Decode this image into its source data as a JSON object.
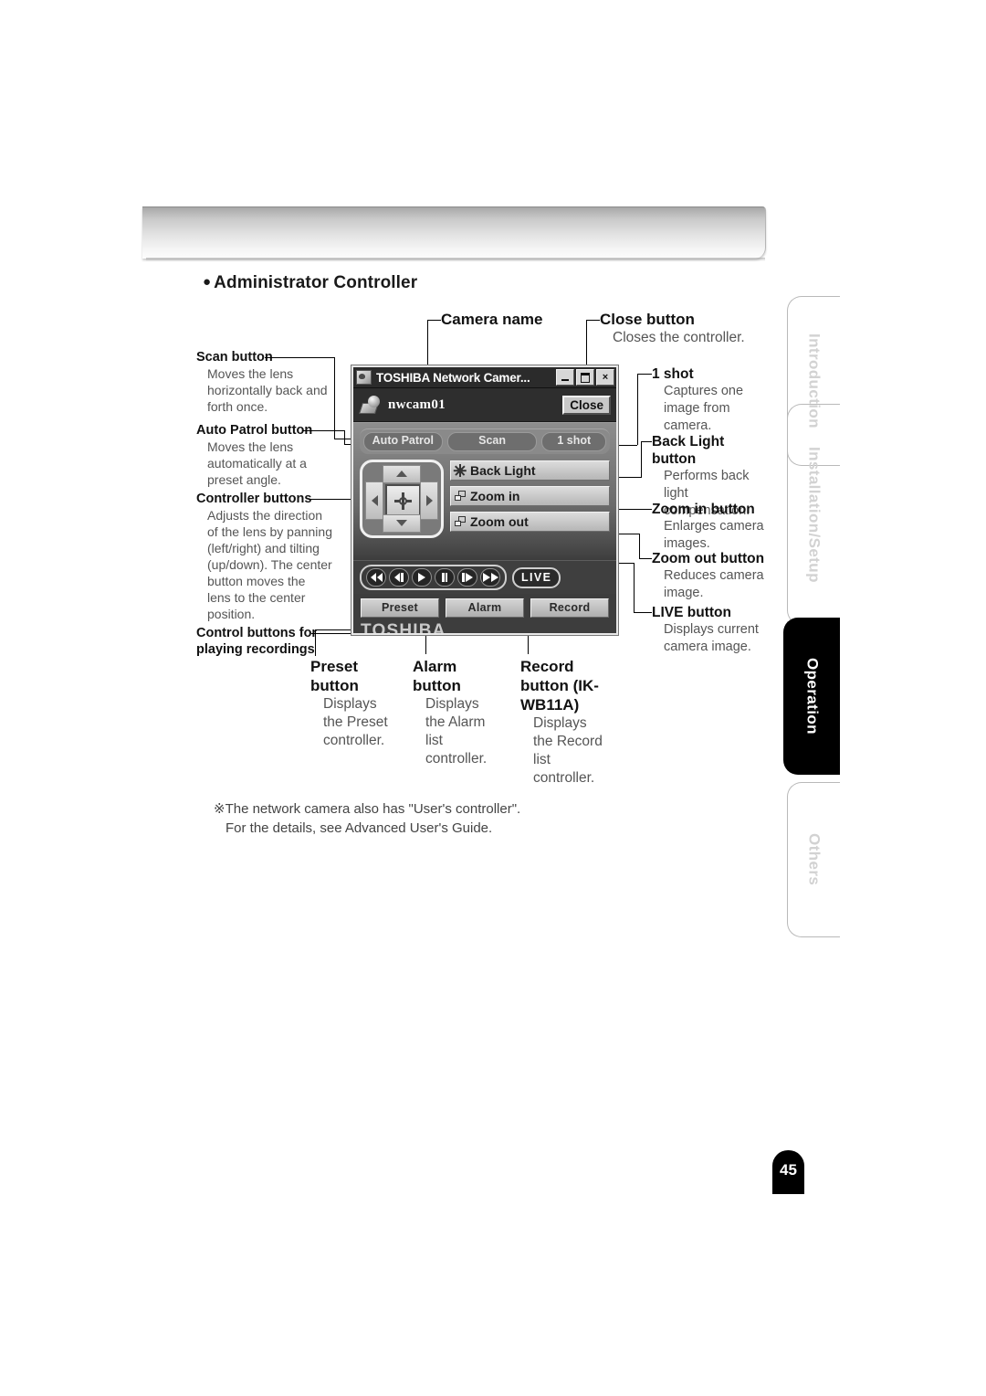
{
  "page": {
    "number": "45",
    "heading": "Administrator Controller",
    "heading_bullet": "●"
  },
  "sidebar": {
    "tabs": [
      {
        "label": "Introduction",
        "active": false
      },
      {
        "label": "Installation/Setup",
        "active": false
      },
      {
        "label": "Operation",
        "active": true
      },
      {
        "label": "Others",
        "active": false
      }
    ]
  },
  "app_window": {
    "titlebar": {
      "title": "TOSHIBA Network Camer...",
      "minimize_label": "",
      "maximize_label": "",
      "close_label": "×"
    },
    "camera_name": "nwcam01",
    "close_button": "Close",
    "top_buttons": [
      {
        "label": "Auto Patrol"
      },
      {
        "label": "Scan"
      },
      {
        "label": "1 shot"
      }
    ],
    "side_buttons": [
      {
        "label": "Back Light",
        "icon": "sun-icon"
      },
      {
        "label": "Zoom in",
        "icon": "zoom-in-icon"
      },
      {
        "label": "Zoom out",
        "icon": "zoom-out-icon"
      }
    ],
    "playback": {
      "buttons": [
        {
          "name": "rewind"
        },
        {
          "name": "step-back"
        },
        {
          "name": "play"
        },
        {
          "name": "pause"
        },
        {
          "name": "step-forward"
        },
        {
          "name": "fast-forward"
        }
      ],
      "live_label": "LIVE"
    },
    "bottom_buttons": [
      {
        "label": "Preset"
      },
      {
        "label": "Alarm"
      },
      {
        "label": "Record"
      }
    ],
    "brand": "TOSHIBA"
  },
  "annotations": {
    "camera_name": {
      "title": "Camera name",
      "desc": ""
    },
    "close_button": {
      "title": "Close button",
      "desc": "Closes the controller."
    },
    "scan": {
      "title": "Scan button",
      "desc": "Moves the lens\nhorizontally back and\nforth once."
    },
    "auto_patrol": {
      "title": "Auto Patrol button",
      "desc": "Moves the lens\nautomatically at a\npreset angle."
    },
    "controller_buttons": {
      "title": "Controller buttons",
      "desc": "Adjusts the direction\nof the lens by panning\n(left/right) and tilting\n(up/down). The center\nbutton moves the\nlens to the center\nposition."
    },
    "playback_controls": {
      "title": "Control buttons for\nplaying recordings",
      "desc": ""
    },
    "one_shot": {
      "title": "1 shot",
      "desc": "Captures one\nimage from\ncamera."
    },
    "back_light": {
      "title": "Back Light button",
      "desc": "Performs back\nlight\ncompensation."
    },
    "zoom_in": {
      "title": "Zoom in button",
      "desc": "Enlarges camera\nimages."
    },
    "zoom_out": {
      "title": "Zoom out button",
      "desc": "Reduces camera\nimage."
    },
    "live": {
      "title": "LIVE button",
      "desc": "Displays current\ncamera image."
    },
    "preset": {
      "title": "Preset\nbutton",
      "desc": "Displays\nthe Preset\ncontroller."
    },
    "alarm": {
      "title": "Alarm button",
      "desc": "Displays\nthe Alarm\nlist\ncontroller."
    },
    "record": {
      "title": "Record\nbutton (IK-\nWB11A)",
      "desc": "Displays\nthe Record\nlist\ncontroller."
    }
  },
  "footnote": {
    "line1": "※The network camera also has \"User's controller\".",
    "line2": "For the details, see Advanced User's Guide."
  }
}
